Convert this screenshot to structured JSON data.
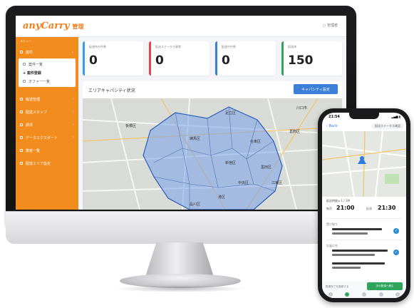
{
  "app": {
    "logo_text": "anyCarry",
    "logo_suffix": "管理",
    "user_menu": "○ 管理者"
  },
  "sidebar": {
    "header": "メニュー",
    "items": [
      {
        "label": "案件"
      },
      {
        "label": "輸送管理"
      },
      {
        "label": "配送スタッフ"
      },
      {
        "label": "請求"
      },
      {
        "label": "データエクスポート"
      },
      {
        "label": "業者一覧"
      },
      {
        "label": "配達エリア設定"
      }
    ],
    "sub_items": [
      {
        "label": "案件一覧"
      },
      {
        "label": "+ 案件登録"
      },
      {
        "label": "オファー一覧"
      }
    ]
  },
  "cards": [
    {
      "label": "配達待ち件数",
      "value": "0",
      "color": "#39a0d8"
    },
    {
      "label": "配送ステータス異常",
      "value": "0",
      "color": "#e0474c"
    },
    {
      "label": "配達中件数",
      "value": "0",
      "color": "#3c7fd8"
    },
    {
      "label": "配達済",
      "value": "150",
      "color": "#2ea55a"
    }
  ],
  "area": {
    "title": "エリアキャパシティ状況",
    "button": "キャパシティ設定"
  },
  "map_labels": [
    {
      "text": "足立区"
    },
    {
      "text": "葛飾区"
    },
    {
      "text": "板橋区"
    },
    {
      "text": "練馬区"
    },
    {
      "text": "新宿区"
    },
    {
      "text": "台東区"
    },
    {
      "text": "墨田区"
    },
    {
      "text": "江東区"
    },
    {
      "text": "中央区"
    },
    {
      "text": "港区"
    },
    {
      "text": "品川区"
    },
    {
      "text": "川口市"
    }
  ],
  "phone": {
    "time": "21:54",
    "back": "‹ Back",
    "nav_chip": "配送ステータス確認",
    "panel_head": "配送時間 ▸ 1 / 3件",
    "pickup_label": "集荷",
    "pickup_time": "21:00",
    "delivery_label": "配達",
    "delivery_time": "21:30",
    "stop1": "受け取り",
    "stop2": "お届け先",
    "btn_ghost": "配達完了を登録する",
    "btn_green": "次の配達へ進む"
  },
  "colors": {
    "brand_orange": "#f28c1e",
    "accent_blue": "#3c7fd8",
    "success_green": "#2ea55a"
  }
}
